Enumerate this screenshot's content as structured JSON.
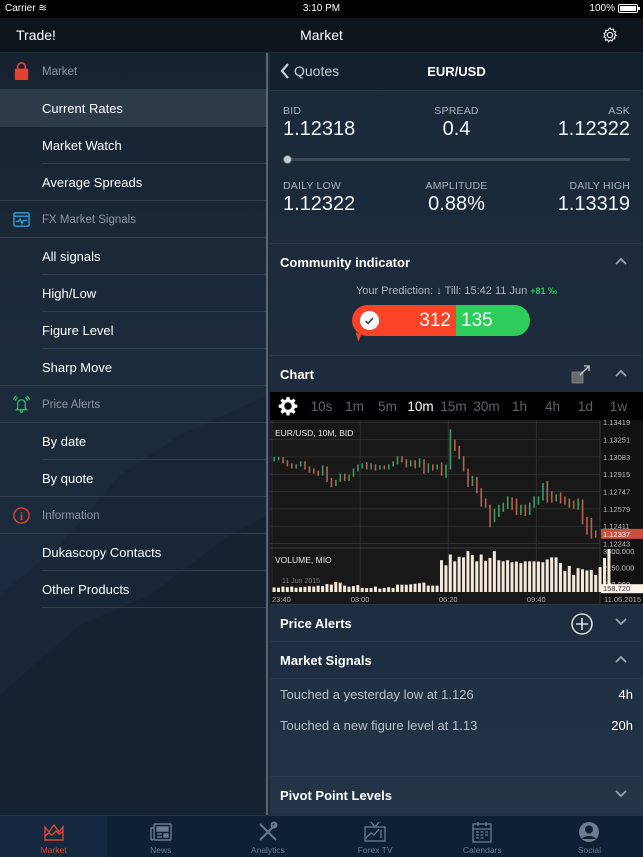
{
  "status_bar": {
    "carrier": "Carrier",
    "time": "3:10 PM",
    "battery": "100%"
  },
  "nav": {
    "left": "Trade!",
    "title": "Market",
    "settings_icon": "gear-icon"
  },
  "sidebar": {
    "sections": [
      {
        "header": "Market",
        "icon": "shopping-bag-icon",
        "icon_color": "#e8412b",
        "items": [
          "Current Rates",
          "Market Watch",
          "Average Spreads"
        ],
        "active": "Current Rates"
      },
      {
        "header": "FX Market Signals",
        "icon": "signal-monitor-icon",
        "icon_color": "#2a9fd6",
        "items": [
          "All signals",
          "High/Low",
          "Figure Level",
          "Sharp Move"
        ]
      },
      {
        "header": "Price Alerts",
        "icon": "ringing-bell-icon",
        "icon_color": "#2fb85a",
        "items": [
          "By date",
          "By quote"
        ]
      },
      {
        "header": "Information",
        "icon": "info-icon",
        "icon_color": "#d9432e",
        "items": [
          "Dukascopy Contacts",
          "Other Products"
        ]
      }
    ]
  },
  "quote": {
    "back_label": "Quotes",
    "pair": "EUR/USD",
    "bid_label": "BID",
    "bid": "1.12318",
    "spread_label": "SPREAD",
    "spread": "0.4",
    "ask_label": "ASK",
    "ask": "1.12322",
    "position_in_range": 0.0,
    "daily_low_label": "DAILY LOW",
    "daily_low": "1.12322",
    "amplitude_label": "AMPLITUDE",
    "amplitude": "0.88%",
    "daily_high_label": "DAILY HIGH",
    "daily_high": "1.13319"
  },
  "community": {
    "title": "Community indicator",
    "prediction_label": "Your Prediction:",
    "prediction_arrow": "↓",
    "till": "Till: 15:42 11 Jun",
    "change": "+81 ‰",
    "down_votes": "312",
    "up_votes": "135",
    "colors": {
      "down": "#fa4327",
      "up": "#2ecc5a"
    }
  },
  "chart_section": {
    "title": "Chart",
    "timeframes": [
      "10s",
      "1m",
      "5m",
      "10m",
      "15m",
      "30m",
      "1h",
      "4h",
      "1d",
      "1w"
    ],
    "selected_timeframe": "10m"
  },
  "chart_data": {
    "type": "bar",
    "title": "EUR/USD, 10M, BID",
    "volume_title": "VOLUME, MIO",
    "watermark": "11 Jun 2015",
    "price_ticks": [
      "1.13419",
      "1.13251",
      "1.13083",
      "1.12915",
      "1.12747",
      "1.12579",
      "1.12411",
      "1.12243"
    ],
    "price_range": [
      1.122,
      1.1344
    ],
    "current_price": "1.12337",
    "volume_ticks": [
      "3600.000",
      "2150.000",
      "700.000"
    ],
    "current_volume": "158.720",
    "volume_range": [
      0,
      3700
    ],
    "x_ticks": [
      "23:40",
      "03:00",
      "06:20",
      "09:40",
      "11.06.2015"
    ],
    "colors": {
      "up": "#3f9a64",
      "down": "#b9604f",
      "volume": "#f5e9dc",
      "price_tag": "#c9503c"
    },
    "ohlc": [
      [
        1.1306,
        1.1308,
        1.1304,
        1.1306
      ],
      [
        1.1306,
        1.1308,
        1.1305,
        1.1307
      ],
      [
        1.1307,
        1.1308,
        1.1302,
        1.1303
      ],
      [
        1.1303,
        1.1305,
        1.1299,
        1.1301
      ],
      [
        1.1301,
        1.1302,
        1.1297,
        1.1298
      ],
      [
        1.1298,
        1.1301,
        1.1297,
        1.13
      ],
      [
        1.13,
        1.1304,
        1.1299,
        1.1303
      ],
      [
        1.1303,
        1.1304,
        1.1296,
        1.1298
      ],
      [
        1.1298,
        1.1299,
        1.1293,
        1.1295
      ],
      [
        1.1295,
        1.1297,
        1.1292,
        1.1293
      ],
      [
        1.1293,
        1.1295,
        1.129,
        1.1291
      ],
      [
        1.1291,
        1.13,
        1.129,
        1.1298
      ],
      [
        1.1298,
        1.1299,
        1.1284,
        1.1286
      ],
      [
        1.1286,
        1.1288,
        1.1279,
        1.1281
      ],
      [
        1.1281,
        1.1286,
        1.128,
        1.1285
      ],
      [
        1.1285,
        1.1292,
        1.1284,
        1.129
      ],
      [
        1.129,
        1.1292,
        1.1285,
        1.1286
      ],
      [
        1.1286,
        1.1291,
        1.1285,
        1.129
      ],
      [
        1.129,
        1.1297,
        1.1289,
        1.1295
      ],
      [
        1.1295,
        1.1301,
        1.1294,
        1.1299
      ],
      [
        1.1299,
        1.1302,
        1.1297,
        1.13
      ],
      [
        1.13,
        1.1303,
        1.1296,
        1.1298
      ],
      [
        1.1298,
        1.1302,
        1.1296,
        1.13
      ],
      [
        1.13,
        1.1301,
        1.1295,
        1.1297
      ],
      [
        1.1297,
        1.13,
        1.1296,
        1.1299
      ],
      [
        1.1299,
        1.13,
        1.1296,
        1.1297
      ],
      [
        1.1297,
        1.1301,
        1.1296,
        1.13
      ],
      [
        1.13,
        1.1304,
        1.1299,
        1.1302
      ],
      [
        1.1302,
        1.1309,
        1.1301,
        1.1307
      ],
      [
        1.1307,
        1.1309,
        1.1303,
        1.1304
      ],
      [
        1.1304,
        1.1306,
        1.1298,
        1.13
      ],
      [
        1.13,
        1.1305,
        1.1299,
        1.1303
      ],
      [
        1.1303,
        1.1305,
        1.1297,
        1.13
      ],
      [
        1.13,
        1.1307,
        1.1298,
        1.1305
      ],
      [
        1.1305,
        1.1306,
        1.1292,
        1.1294
      ],
      [
        1.1294,
        1.1302,
        1.1293,
        1.13
      ],
      [
        1.13,
        1.1301,
        1.1295,
        1.1297
      ],
      [
        1.1297,
        1.1301,
        1.1296,
        1.1298
      ],
      [
        1.1298,
        1.1303,
        1.129,
        1.1292
      ],
      [
        1.1292,
        1.1301,
        1.1288,
        1.1298
      ],
      [
        1.1298,
        1.1335,
        1.1296,
        1.132
      ],
      [
        1.132,
        1.1325,
        1.1314,
        1.1316
      ],
      [
        1.1316,
        1.1319,
        1.1306,
        1.1308
      ],
      [
        1.1308,
        1.1309,
        1.1294,
        1.1296
      ],
      [
        1.1296,
        1.1297,
        1.1279,
        1.1282
      ],
      [
        1.1282,
        1.129,
        1.128,
        1.1288
      ],
      [
        1.1288,
        1.1289,
        1.1273,
        1.1276
      ],
      [
        1.1276,
        1.1278,
        1.126,
        1.1263
      ],
      [
        1.1263,
        1.1268,
        1.1259,
        1.1261
      ],
      [
        1.1261,
        1.1262,
        1.124,
        1.1248
      ],
      [
        1.1248,
        1.1258,
        1.1245,
        1.1255
      ],
      [
        1.1255,
        1.1262,
        1.125,
        1.1259
      ],
      [
        1.1259,
        1.1264,
        1.1255,
        1.1262
      ],
      [
        1.1262,
        1.127,
        1.1258,
        1.1267
      ],
      [
        1.1267,
        1.1269,
        1.1257,
        1.1265
      ],
      [
        1.1265,
        1.1268,
        1.1252,
        1.1255
      ],
      [
        1.1255,
        1.1262,
        1.1252,
        1.126
      ],
      [
        1.126,
        1.1262,
        1.1251,
        1.1253
      ],
      [
        1.1253,
        1.1264,
        1.1252,
        1.1261
      ],
      [
        1.1261,
        1.127,
        1.1259,
        1.1266
      ],
      [
        1.1266,
        1.127,
        1.1262,
        1.1268
      ],
      [
        1.1268,
        1.1283,
        1.1266,
        1.128
      ],
      [
        1.128,
        1.1285,
        1.1264,
        1.1272
      ],
      [
        1.1272,
        1.1275,
        1.1264,
        1.1266
      ],
      [
        1.1266,
        1.1272,
        1.1265,
        1.127
      ],
      [
        1.127,
        1.1274,
        1.1263,
        1.1268
      ],
      [
        1.1268,
        1.127,
        1.1262,
        1.1265
      ],
      [
        1.1265,
        1.1268,
        1.1259,
        1.1262
      ],
      [
        1.1262,
        1.1266,
        1.1258,
        1.126
      ],
      [
        1.126,
        1.1268,
        1.1257,
        1.1266
      ],
      [
        1.1266,
        1.1267,
        1.1243,
        1.1249
      ],
      [
        1.1249,
        1.125,
        1.1233,
        1.1238
      ],
      [
        1.1238,
        1.1249,
        1.1229,
        1.1233
      ],
      [
        1.1234,
        1.1237,
        1.123,
        1.1233
      ]
    ],
    "volume": [
      400,
      380,
      480,
      420,
      480,
      380,
      420,
      460,
      500,
      480,
      560,
      520,
      700,
      650,
      880,
      820,
      560,
      470,
      520,
      610,
      360,
      340,
      340,
      480,
      300,
      360,
      420,
      360,
      650,
      640,
      640,
      680,
      720,
      770,
      830,
      570,
      560,
      560,
      2800,
      2350,
      3300,
      2700,
      3100,
      3050,
      3600,
      3250,
      2700,
      3300,
      2750,
      3000,
      3600,
      2800,
      2700,
      2800,
      2620,
      2680,
      2540,
      2700,
      2700,
      2700,
      2680,
      2620,
      2860,
      3050,
      3050,
      2550,
      1850,
      2300,
      1500,
      2100,
      2000,
      1900,
      1950,
      1500,
      2200,
      3000,
      3800,
      150
    ]
  },
  "price_alerts": {
    "title": "Price Alerts",
    "add_icon": "plus-circle-icon"
  },
  "market_signals": {
    "title": "Market Signals",
    "items": [
      {
        "text": "Touched a yesterday low  at 1.126",
        "age": "4h"
      },
      {
        "text": "Touched a new figure level at 1.13",
        "age": "20h"
      }
    ]
  },
  "pivot": {
    "title": "Pivot Point Levels"
  },
  "tabbar": {
    "tabs": [
      {
        "label": "Market",
        "icon": "crown-chart-icon",
        "active": true
      },
      {
        "label": "News",
        "icon": "newspaper-icon"
      },
      {
        "label": "Analytics",
        "icon": "tools-icon"
      },
      {
        "label": "Forex TV",
        "icon": "tv-icon"
      },
      {
        "label": "Calendars",
        "icon": "calendar-icon"
      },
      {
        "label": "Social",
        "icon": "person-icon"
      }
    ]
  }
}
